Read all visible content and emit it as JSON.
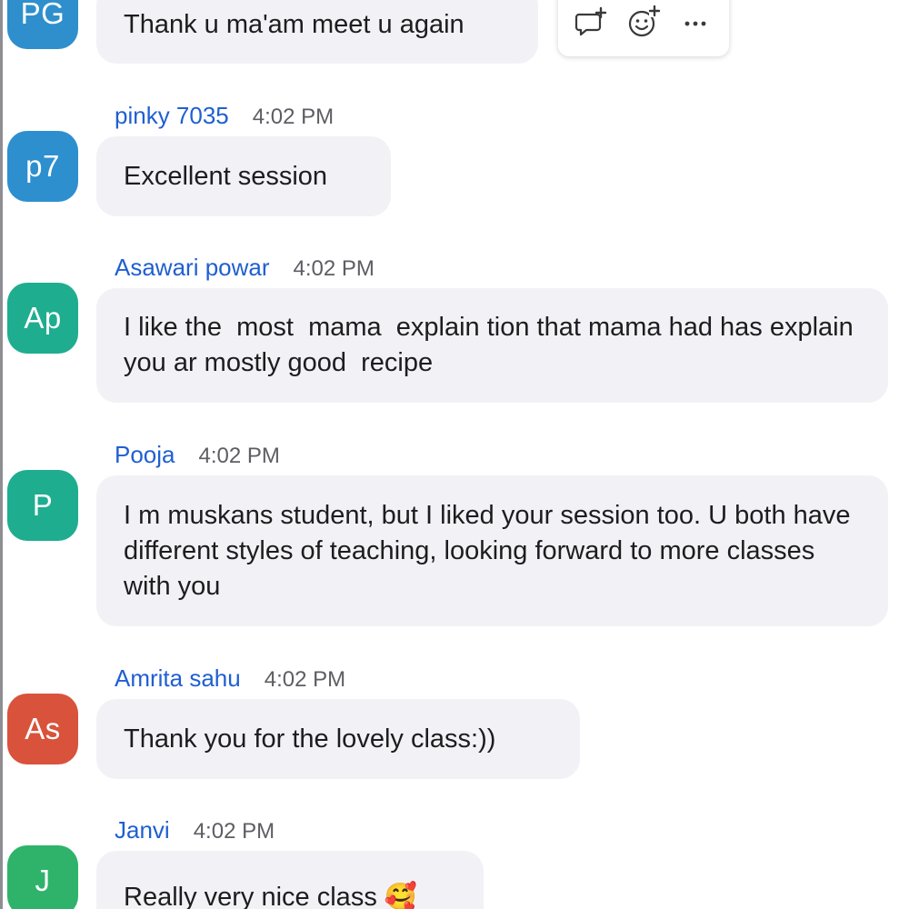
{
  "colors": {
    "name_blue": "#1f5fd1",
    "bubble_bg": "#f2f2f6",
    "time_gray": "#5d5d63"
  },
  "hover_toolbar": {
    "reply_icon": "reply-thread-icon",
    "react_icon": "add-reaction-icon",
    "more_icon": "more-options-icon"
  },
  "messages": [
    {
      "initials": "PG",
      "avatar_color": "#2f8fcc",
      "sender": "",
      "time": "",
      "text": "Thank u ma'am meet u again"
    },
    {
      "initials": "p7",
      "avatar_color": "#2e8fcf",
      "sender": "pinky 7035",
      "time": "4:02 PM",
      "text": "Excellent session"
    },
    {
      "initials": "Ap",
      "avatar_color": "#1fad8f",
      "sender": "Asawari powar",
      "time": "4:02 PM",
      "text": "I like the  most  mama  explain tion that mama had has explain you ar mostly good  recipe"
    },
    {
      "initials": "P",
      "avatar_color": "#1fad8f",
      "sender": "Pooja",
      "time": "4:02 PM",
      "text": "I m muskans student, but I liked your session too. U both have different styles of teaching, looking forward to more classes with you"
    },
    {
      "initials": "As",
      "avatar_color": "#d9523b",
      "sender": "Amrita sahu",
      "time": "4:02 PM",
      "text": "Thank you for the lovely class:))"
    },
    {
      "initials": "J",
      "avatar_color": "#2fb36a",
      "sender": "Janvi",
      "time": "4:02 PM",
      "text": "Really very nice class 🥰"
    }
  ]
}
